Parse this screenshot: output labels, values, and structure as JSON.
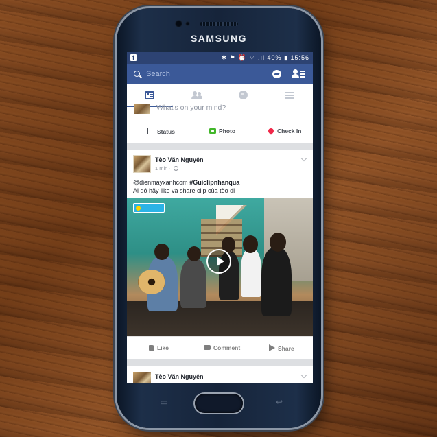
{
  "device": {
    "brand": "SAMSUNG"
  },
  "status_bar": {
    "battery": "40%",
    "time": "15:56",
    "signal_icons": "✱ ⚑ ⏰ ⌔ .ıl"
  },
  "search": {
    "placeholder": "Search"
  },
  "tabs": [
    {
      "name": "news-feed",
      "active": true
    },
    {
      "name": "friend-requests",
      "active": false
    },
    {
      "name": "notifications",
      "active": false
    },
    {
      "name": "more",
      "active": false
    }
  ],
  "composer": {
    "prompt": "What's on your mind?",
    "status_label": "Status",
    "photo_label": "Photo",
    "checkin_label": "Check In"
  },
  "post": {
    "author": "Tèo Văn Nguyên",
    "time": "1 min",
    "mention": "@dienmayxanhcom",
    "hashtag": "#Guiclipnhanqua",
    "line2": "Ai đó hãy like và share clip của tèo đi",
    "like_label": "Like",
    "comment_label": "Comment",
    "share_label": "Share"
  },
  "post2": {
    "author": "Tèo Văn Nguyên"
  },
  "colors": {
    "facebook_blue": "#3b5998",
    "status_blue": "#2d4373",
    "checkin_red": "#f02849",
    "photo_green": "#42b72a"
  }
}
